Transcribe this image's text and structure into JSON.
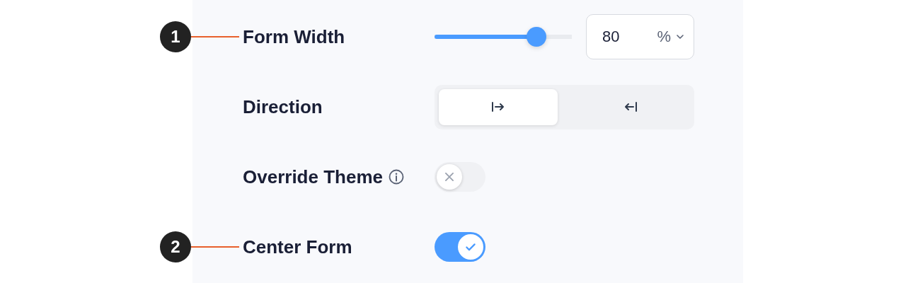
{
  "settings": [
    {
      "kind": "slider",
      "marker": "1",
      "label": "Form Width",
      "level": 0.74,
      "value": "80",
      "unit": "%"
    },
    {
      "kind": "segmented",
      "label": "Direction",
      "options": [
        {
          "selected": true
        },
        {
          "selected": false
        }
      ]
    },
    {
      "kind": "toggle",
      "label": "Override Theme",
      "info": true,
      "on": false
    },
    {
      "kind": "toggle",
      "marker": "2",
      "label": "Center Form",
      "on": true
    }
  ]
}
